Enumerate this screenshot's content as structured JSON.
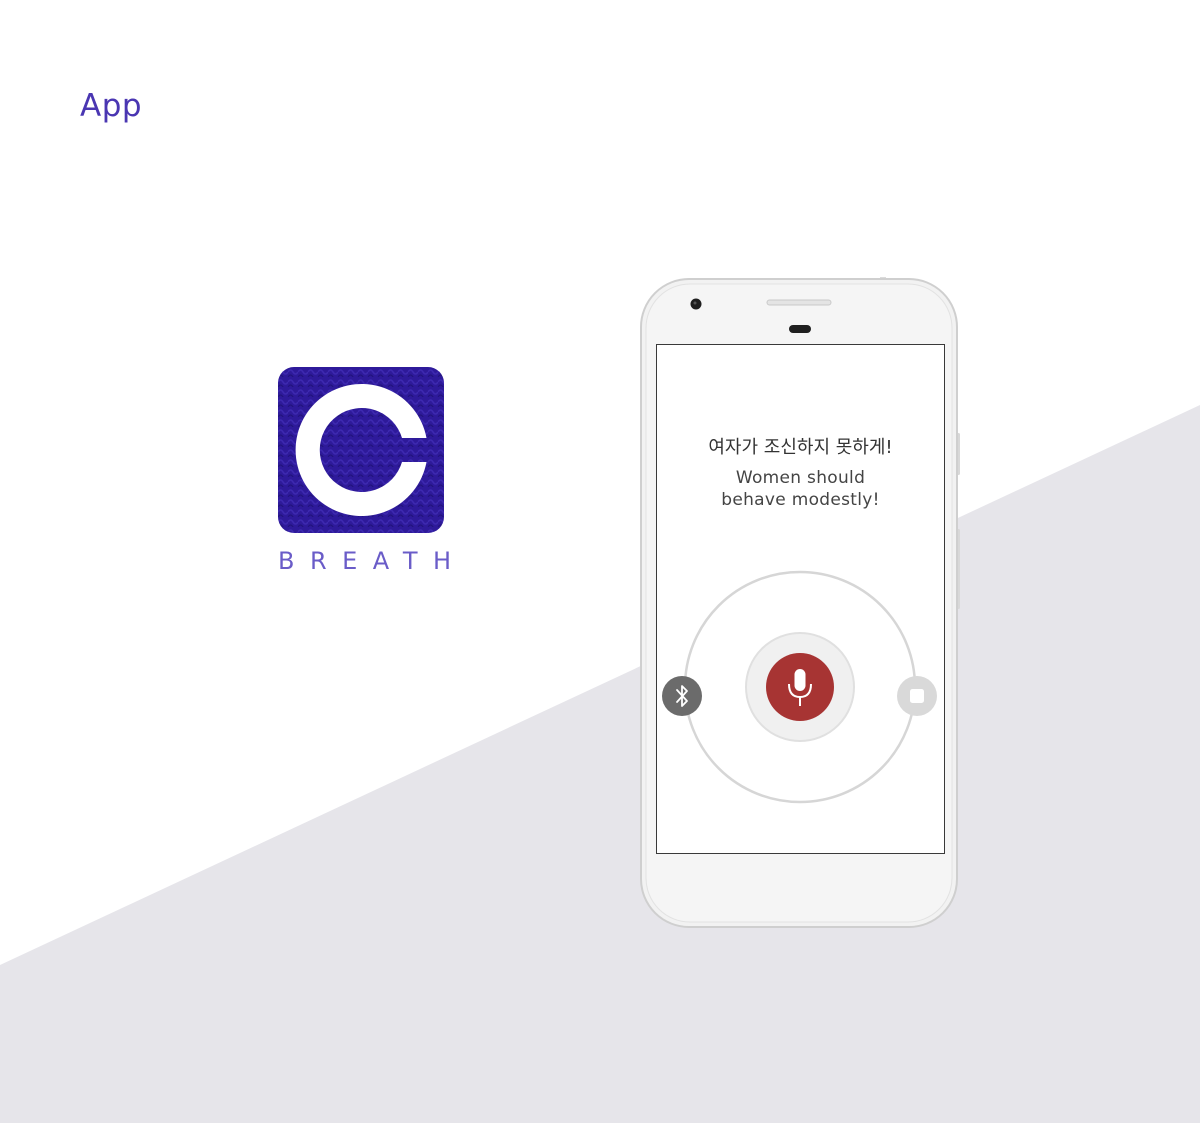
{
  "header": {
    "title": "App"
  },
  "brand": {
    "name": "BREATH",
    "logo_icon": "c-logo-icon",
    "accent_color": "#2e1a9a"
  },
  "screen": {
    "phrase_korean": "여자가 조신하지 못하게!",
    "phrase_english_line1": "Women should",
    "phrase_english_line2": "behave modestly!"
  },
  "controls": {
    "left_button_icon": "bluetooth-icon",
    "center_button_icon": "microphone-icon",
    "right_button_icon": "stop-icon",
    "mic_color": "#a73433",
    "bluetooth_color": "#6b6b6b",
    "stop_color": "#d9d9d9"
  },
  "background": {
    "lower_color": "#e6e5ea"
  }
}
